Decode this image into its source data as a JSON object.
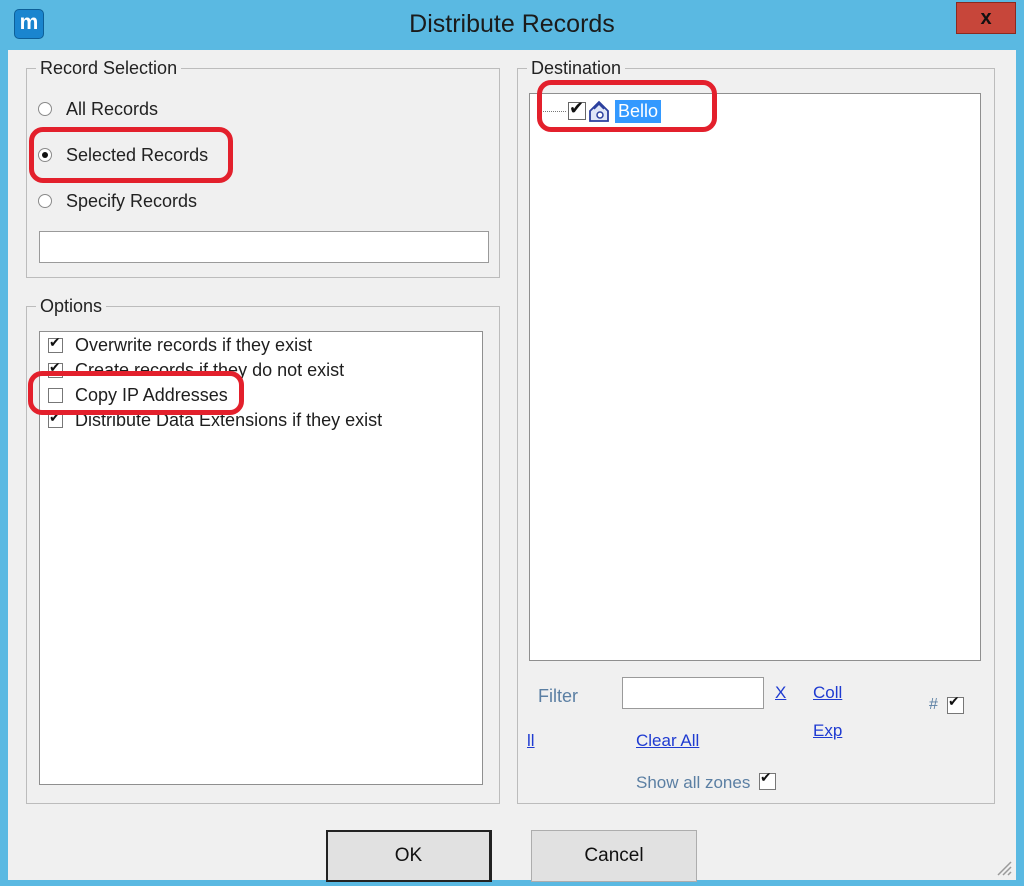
{
  "window": {
    "title": "Distribute Records",
    "app_icon_letter": "m",
    "close_label": "x"
  },
  "record_selection": {
    "legend": "Record Selection",
    "options": [
      {
        "label": "All Records",
        "selected": false
      },
      {
        "label": "Selected Records",
        "selected": true
      },
      {
        "label": "Specify Records",
        "selected": false
      }
    ],
    "specify_value": ""
  },
  "options": {
    "legend": "Options",
    "items": [
      {
        "label": "Overwrite records if they exist",
        "checked": true
      },
      {
        "label": "Create records if they do not exist",
        "checked": true
      },
      {
        "label": "Copy IP Addresses",
        "checked": false
      },
      {
        "label": "Distribute Data Extensions if they exist",
        "checked": true
      }
    ]
  },
  "destination": {
    "legend": "Destination",
    "tree": [
      {
        "label": "Bello",
        "checked": true,
        "selected": true,
        "icon": "house-icon"
      }
    ]
  },
  "filter": {
    "label": "Filter",
    "value": "",
    "clear_x": "X",
    "collapse": "Coll",
    "expand": "Exp",
    "hash_label": "#",
    "hash_checked": true,
    "select_all_partial": "ll",
    "clear_all": "Clear All",
    "show_all_zones": "Show all zones",
    "show_all_zones_checked": true
  },
  "buttons": {
    "ok": "OK",
    "cancel": "Cancel"
  },
  "colors": {
    "frame": "#5ab9e2",
    "highlight": "#e3202c",
    "selection": "#3399ff",
    "link": "#1f3bd1"
  }
}
